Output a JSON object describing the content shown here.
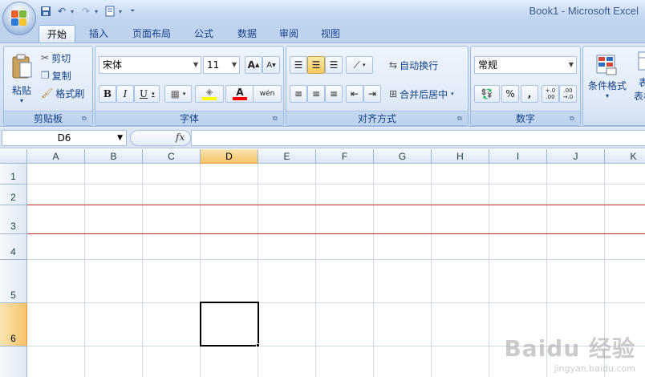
{
  "window": {
    "title": "Book1 - Microsoft Excel"
  },
  "qat": {
    "items": [
      "save-icon",
      "undo-icon",
      "redo-icon",
      "print-preview-icon",
      "customize-icon"
    ]
  },
  "tabs": [
    {
      "label": "开始",
      "active": true
    },
    {
      "label": "插入"
    },
    {
      "label": "页面布局"
    },
    {
      "label": "公式"
    },
    {
      "label": "数据"
    },
    {
      "label": "审阅"
    },
    {
      "label": "视图"
    }
  ],
  "ribbon": {
    "clipboard": {
      "group": "剪贴板",
      "paste": "粘贴",
      "cut": "剪切",
      "copy": "复制",
      "format_painter": "格式刷"
    },
    "font": {
      "group": "字体",
      "font_name": "宋体",
      "font_size": "11",
      "bold": "B",
      "italic": "I",
      "underline": "U",
      "grow": "A",
      "shrink": "A",
      "phonetic": "wén"
    },
    "alignment": {
      "group": "对齐方式",
      "wrap_text": "自动换行",
      "merge_center": "合并后居中"
    },
    "number": {
      "group": "数字",
      "format": "常规",
      "percent": "%",
      "comma": ",",
      "inc_decimal": "+.0 .00",
      "dec_decimal": ".00 →.0"
    },
    "styles": {
      "conditional_format": "条件格式",
      "table_partial": "表",
      "table_partial2": "表格"
    }
  },
  "formula_bar": {
    "name_box": "D6",
    "fx": "fx",
    "value": ""
  },
  "sheet": {
    "columns": [
      "A",
      "B",
      "C",
      "D",
      "E",
      "F",
      "G",
      "H",
      "I",
      "J",
      "K"
    ],
    "rows": [
      "1",
      "2",
      "3",
      "4",
      "5",
      "6"
    ],
    "selected_cell": "D6",
    "selected_column": "D",
    "selected_row": "6"
  },
  "watermark": {
    "main": "Baidu 经验",
    "sub": "jingyan.baidu.com"
  }
}
